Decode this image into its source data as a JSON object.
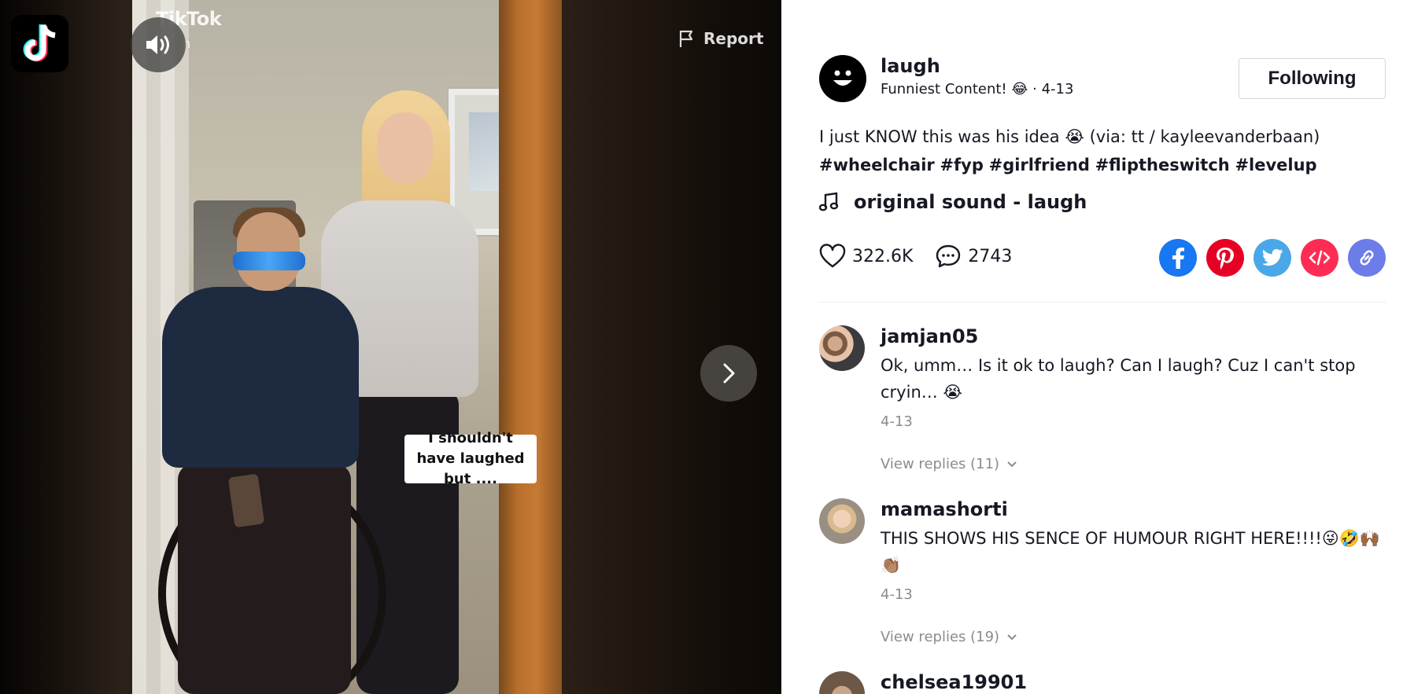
{
  "video": {
    "watermark": "TikTok",
    "watermark_sub": "n",
    "caption": "I shouldn't have laughed but ....",
    "report_label": "Report"
  },
  "author": {
    "name": "laugh",
    "nickname": "Funniest Content! 😂",
    "date": "· 4-13",
    "follow_label": "Following"
  },
  "description": {
    "text": "I just KNOW this was his idea 😭 (via: tt / kayleevanderbaan)",
    "hashtags": [
      "#wheelchair",
      "#fyp",
      "#girlfriend",
      "#fliptheswitch",
      "#levelup"
    ]
  },
  "music": {
    "title": "original sound - laugh"
  },
  "stats": {
    "likes": "322.6K",
    "comments": "2743"
  },
  "share_icons": [
    "facebook-icon",
    "pinterest-icon",
    "twitter-icon",
    "embed-icon",
    "link-icon"
  ],
  "colors": {
    "facebook": "#1877f2",
    "pinterest": "#e60023",
    "twitter": "#4aa8e8",
    "embed": "#fe2c55",
    "link": "#6c7ce8",
    "secondary_text": "#8a8b91"
  },
  "comments": [
    {
      "user": "jamjan05",
      "text": "Ok, umm… Is it ok to laugh? Can I laugh? Cuz I can't stop cryin… 😭",
      "date": "4-13",
      "replies": "View replies (11)"
    },
    {
      "user": "mamashorti",
      "text": "THIS SHOWS HIS SENCE OF HUMOUR RIGHT HERE!!!!😜🤣🙌🏾👏🏽",
      "date": "4-13",
      "replies": "View replies (19)"
    },
    {
      "user": "chelsea19901"
    }
  ]
}
